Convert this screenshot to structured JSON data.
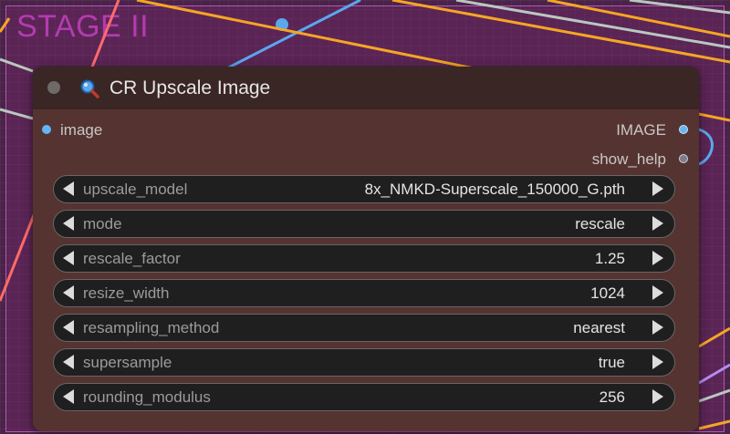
{
  "group": {
    "title": "STAGE II"
  },
  "node": {
    "title": "CR Upscale Image",
    "icon": "magnifier-icon",
    "inputs": [
      {
        "label": "image",
        "color": "#64b5f6"
      }
    ],
    "outputs": [
      {
        "label": "IMAGE",
        "color": "#64b5f6"
      },
      {
        "label": "show_help",
        "color": "#7c7c8a"
      }
    ],
    "widgets": [
      {
        "label": "upscale_model",
        "value": "8x_NMKD-Superscale_150000_G.pth"
      },
      {
        "label": "mode",
        "value": "rescale"
      },
      {
        "label": "rescale_factor",
        "value": "1.25"
      },
      {
        "label": "resize_width",
        "value": "1024"
      },
      {
        "label": "resampling_method",
        "value": "nearest"
      },
      {
        "label": "supersample",
        "value": "true"
      },
      {
        "label": "rounding_modulus",
        "value": "256"
      }
    ]
  },
  "colors": {
    "canvas": "#4a2348",
    "group_title": "#b43bb0",
    "node_body": "#553330",
    "node_header": "#3a2624",
    "wire_orange": "#f5a623",
    "wire_blue": "#5aa7ef",
    "wire_red": "#ff6b6b",
    "wire_gray": "#b9c8c0"
  }
}
